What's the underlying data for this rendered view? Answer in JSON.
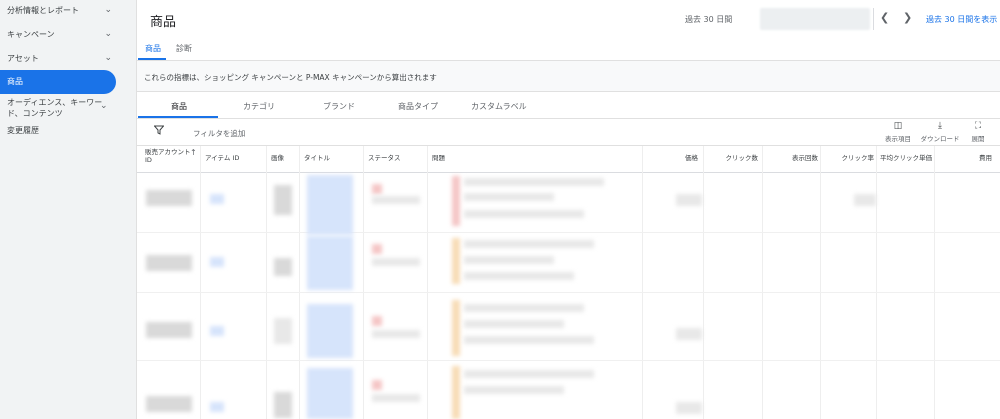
{
  "sidebar": {
    "items": [
      {
        "label": "分析情報とレポート",
        "chevron": "chevron-down-icon"
      },
      {
        "label": "キャンペーン",
        "chevron": "chevron-down-icon"
      },
      {
        "label": "アセット",
        "chevron": "chevron-down-icon"
      },
      {
        "label": "商品",
        "active": true
      },
      {
        "label": "オーディエンス、キーワード、コンテンツ",
        "chevron": "chevron-down-icon"
      },
      {
        "label": "変更履歴"
      }
    ]
  },
  "header": {
    "title": "商品",
    "date_range_label": "過去 30 日間",
    "prev_icon": "chevron-left-icon",
    "next_icon": "chevron-right-icon",
    "show_previous": "過去 30 日間を表示"
  },
  "top_tabs": [
    {
      "label": "商品",
      "active": true
    },
    {
      "label": "診断"
    }
  ],
  "banner": {
    "text": "これらの指標は、ショッピング キャンペーンと P-MAX キャンペーンから算出されます"
  },
  "sub_tabs": [
    {
      "label": "商品",
      "active": true
    },
    {
      "label": "カテゴリ"
    },
    {
      "label": "ブランド"
    },
    {
      "label": "商品タイプ"
    },
    {
      "label": "カスタムラベル"
    }
  ],
  "toolbar": {
    "filter_icon": "filter-icon",
    "filter_label": "フィルタを追加",
    "columns_label": "表示項目",
    "download_label": "ダウンロード",
    "expand_label": "展開"
  },
  "table": {
    "headers": [
      "販売アカウント ID",
      "アイテム ID",
      "画像",
      "タイトル",
      "ステータス",
      "問題",
      "価格",
      "クリック数",
      "表示回数",
      "クリック率",
      "平均クリック単価",
      "費用"
    ],
    "sort_icon": "arrow-up-icon"
  },
  "colors": {
    "accent": "#1a73e8",
    "sidebar_bg": "#f1f3f4"
  }
}
